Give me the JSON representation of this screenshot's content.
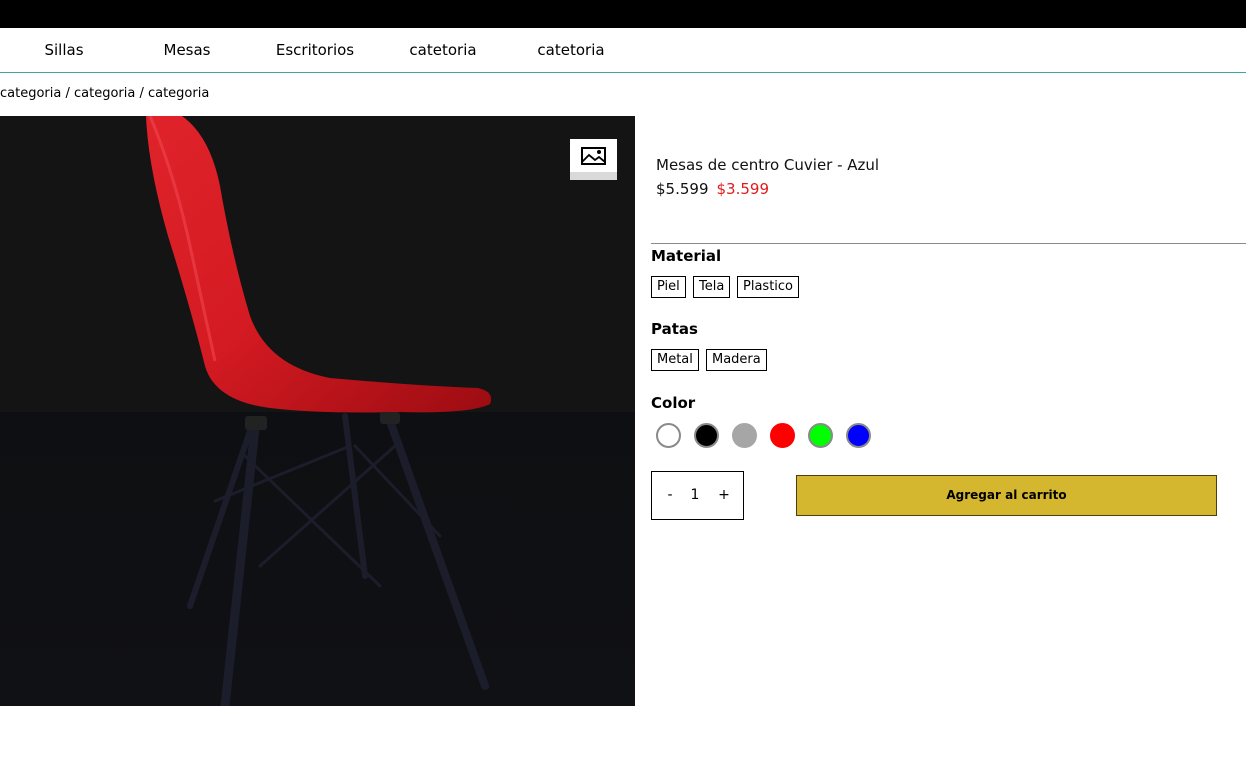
{
  "nav": {
    "items": [
      {
        "label": "Sillas"
      },
      {
        "label": "Mesas"
      },
      {
        "label": "Escritorios"
      },
      {
        "label": "catetoria"
      },
      {
        "label": "catetoria"
      }
    ]
  },
  "breadcrumb": "categoria / categoria / categoria",
  "product": {
    "title": "Mesas de centro Cuvier - Azul",
    "price_old": "$5.599",
    "price_new": "$3.599"
  },
  "options": {
    "material": {
      "label": "Material",
      "values": [
        "Piel",
        "Tela",
        "Plastico"
      ]
    },
    "patas": {
      "label": "Patas",
      "values": [
        "Metal",
        "Madera"
      ]
    },
    "color": {
      "label": "Color",
      "swatches": [
        "#ffffff",
        "#000000",
        "#a6a6a6",
        "#ff0000",
        "#00ff00",
        "#0000ff"
      ]
    }
  },
  "quantity": {
    "minus": "-",
    "value": "1",
    "plus": "+"
  },
  "cart_button": "Agregar al carrito",
  "icons": {
    "gallery": "image-icon"
  }
}
